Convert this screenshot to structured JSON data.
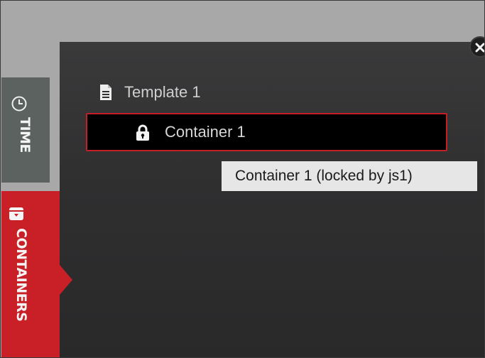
{
  "sidebar": {
    "tabs": [
      {
        "label": "TIME",
        "icon": "clock-icon",
        "active": false,
        "color": "#5c6260"
      },
      {
        "label": "CONTAINERS",
        "icon": "container-box-icon",
        "active": true,
        "color": "#c82026"
      }
    ]
  },
  "tree": {
    "template": {
      "label": "Template 1",
      "icon": "document-icon"
    },
    "container": {
      "label": "Container 1",
      "icon": "lock-icon",
      "selected": true,
      "locked": true
    }
  },
  "tooltip": {
    "text": "Container 1 (locked by js1)"
  },
  "colors": {
    "accent": "#c82026",
    "panel": "#333334",
    "selection_border": "#c41f24",
    "tooltip_bg": "#e6e6e6"
  }
}
